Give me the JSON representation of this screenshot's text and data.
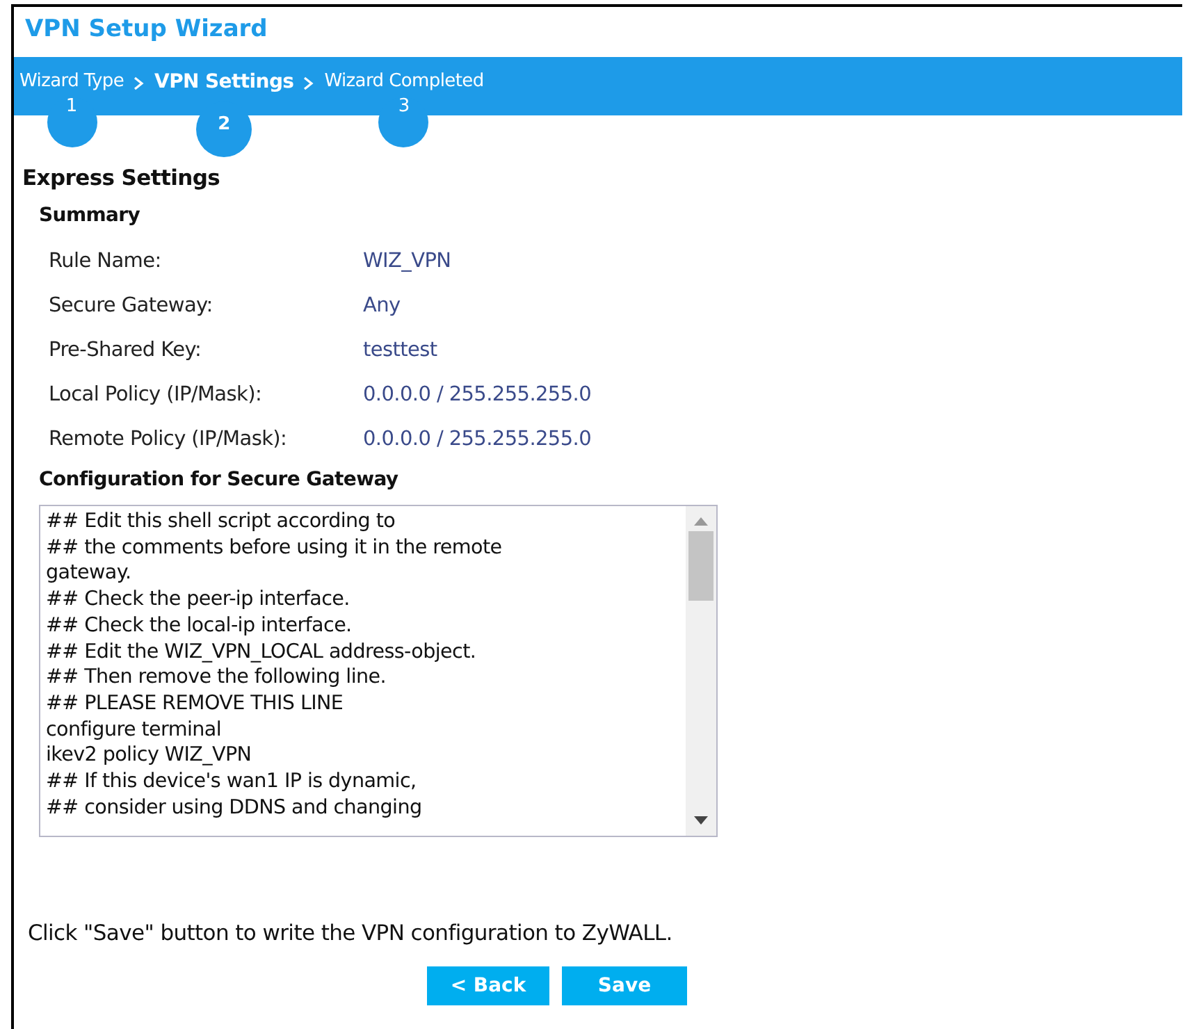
{
  "window": {
    "title": "VPN Setup Wizard"
  },
  "steps": [
    {
      "label": "Wizard Type",
      "number": "1",
      "selected": false
    },
    {
      "label": "VPN Settings",
      "number": "2",
      "selected": true
    },
    {
      "label": "Wizard Completed",
      "number": "3",
      "selected": false
    }
  ],
  "section_title": "Express Settings",
  "summary": {
    "title": "Summary",
    "rows": [
      {
        "label": "Rule Name:",
        "value": "WIZ_VPN"
      },
      {
        "label": "Secure Gateway:",
        "value": "Any"
      },
      {
        "label": "Pre-Shared Key:",
        "value": "testtest"
      },
      {
        "label": "Local Policy (IP/Mask):",
        "value": "0.0.0.0 / 255.255.255.0"
      },
      {
        "label": "Remote Policy (IP/Mask):",
        "value": "0.0.0.0 / 255.255.255.0"
      }
    ]
  },
  "configuration": {
    "title": "Configuration for Secure Gateway",
    "lines": [
      "## Edit this shell script according to",
      "## the comments before using it in the remote",
      "gateway.",
      "## Check the peer-ip interface.",
      "## Check the local-ip interface.",
      "## Edit the WIZ_VPN_LOCAL address-object.",
      "## Then remove the following line.",
      "## PLEASE REMOVE THIS LINE",
      "configure terminal",
      "ikev2 policy WIZ_VPN",
      "## If this device's wan1 IP is dynamic,",
      "## consider using DDNS and changing"
    ]
  },
  "footer_text": "Click \"Save\" button to write the VPN configuration to ZyWALL.",
  "buttons": [
    "< Back",
    "Save"
  ]
}
